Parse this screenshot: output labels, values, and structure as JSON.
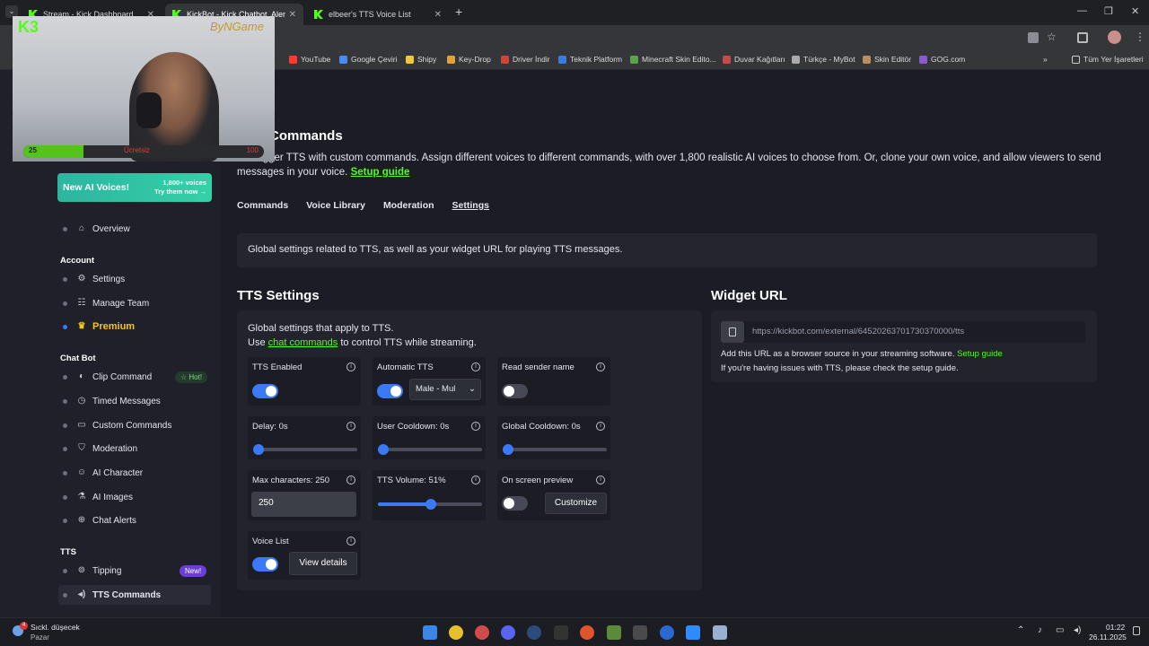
{
  "browser": {
    "tabs": [
      {
        "title": "Stream - Kick Dashboard",
        "active": false
      },
      {
        "title": "KickBot - Kick Chatbot, Alerts, T",
        "active": true
      },
      {
        "title": "elbeer's TTS Voice List",
        "active": false
      }
    ],
    "new_tab": "+",
    "bookmarks": [
      "YouTube",
      "Google Çeviri",
      "Shipy",
      "Key-Drop",
      "Driver İndir",
      "Teknik Platform",
      "Minecraft Skin Edito...",
      "Duvar Kağıtları",
      "Türkçe - MyBot",
      "Skin Editör",
      "GOG.com"
    ],
    "bookmarks_more": "»",
    "all_bookmarks": "Tüm Yer İşaretleri"
  },
  "webcam": {
    "logo": "K3",
    "watermark": "ByNGame",
    "bar_left": "25",
    "bar_mid": "Ücretsiz",
    "bar_right": "100",
    "bar_fill": 0.25
  },
  "sidebar": {
    "banner": {
      "title": "New AI Voices!",
      "line1": "1,800+ voices",
      "line2": "Try them now →"
    },
    "overview": "Overview",
    "account_heading": "Account",
    "account_items": [
      {
        "label": "Settings",
        "icon": "gear-icon"
      },
      {
        "label": "Manage Team",
        "icon": "team-icon"
      },
      {
        "label": "Premium",
        "icon": "crown-icon"
      }
    ],
    "chatbot_heading": "Chat Bot",
    "chatbot_items": [
      {
        "label": "Clip Command",
        "icon": "clip-icon"
      },
      {
        "label": "Timed Messages",
        "icon": "clock-icon"
      },
      {
        "label": "Custom Commands",
        "icon": "terminal-icon"
      },
      {
        "label": "Moderation",
        "icon": "shield-icon"
      },
      {
        "label": "AI Character",
        "icon": "robot-icon"
      },
      {
        "label": "AI Images",
        "icon": "flask-icon"
      },
      {
        "label": "Chat Alerts",
        "icon": "globe-icon"
      }
    ],
    "hot_badge": "☆ Hot!",
    "tts_heading": "TTS",
    "tts_items": [
      {
        "label": "Tipping",
        "icon": "coin-icon"
      },
      {
        "label": "TTS Commands",
        "icon": "speaker-icon"
      }
    ],
    "new_badge": "New!"
  },
  "main": {
    "title": "Commands",
    "intro_text": "ers trigger TTS with custom commands. Assign different voices to different commands, with over 1,800 realistic AI voices to choose from. Or, clone your own voice, and allow viewers to send messages in your voice.",
    "intro_link": "Setup guide",
    "subnav": [
      "Commands",
      "Voice Library",
      "Moderation",
      "Settings"
    ],
    "subnav_selected": "Settings",
    "info": "Global settings related to TTS, as well as your widget URL for playing TTS messages.",
    "tts_settings": {
      "title": "TTS Settings",
      "desc_line1": "Global settings that apply to TTS.",
      "desc_use": "Use",
      "desc_link": "chat commands",
      "desc_rest": "to control TTS while streaming.",
      "tts_enabled": "TTS Enabled",
      "automatic_tts": "Automatic TTS",
      "automatic_select": "Male - Mul",
      "read_sender": "Read sender name",
      "delay": "Delay: 0s",
      "user_cooldown": "User Cooldown: 0s",
      "global_cooldown": "Global Cooldown: 0s",
      "max_chars": "Max characters: 250",
      "max_chars_value": "250",
      "volume": "TTS Volume: 51%",
      "volume_value": 0.51,
      "preview": "On screen preview",
      "customize": "Customize",
      "voice_list": "Voice List",
      "view_details": "View details"
    },
    "widget": {
      "title": "Widget URL",
      "url": "https://kickbot.com/external/64520263701730370000/tts",
      "help1": "Add this URL as a browser source in your streaming software.",
      "help1_link": "Setup guide",
      "help2": "If you're having issues with TTS, please check the setup guide."
    }
  },
  "taskbar": {
    "weather": "Sıckl. düşecek",
    "day": "Pazar",
    "weather_badge": "4",
    "time": "01:22",
    "date": "26.11.2025"
  }
}
